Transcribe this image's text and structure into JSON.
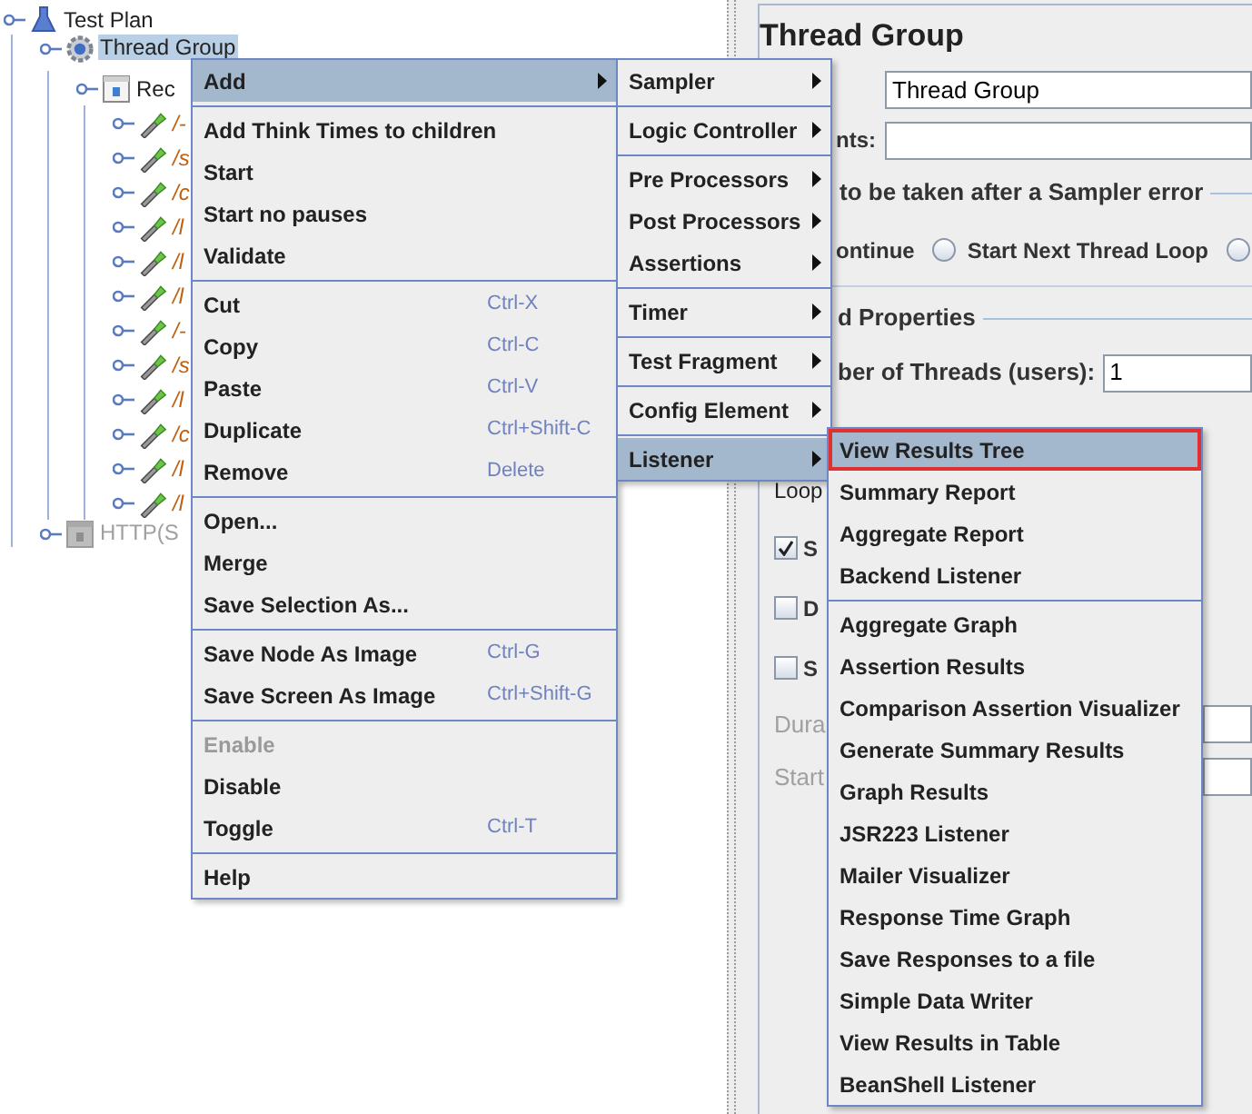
{
  "tree": [
    {
      "label": "Test Plan",
      "kind": "flask",
      "selected": false,
      "disabled": false,
      "children": [
        {
          "label": "Thread Group",
          "kind": "gear",
          "selected": true,
          "disabled": false,
          "children": [
            {
              "label": "Rec",
              "kind": "recorder",
              "selected": false,
              "disabled": false,
              "children": [
                {
                  "label": "/-",
                  "kind": "sampler",
                  "selected": false,
                  "disabled": false
                },
                {
                  "label": "/s",
                  "kind": "sampler",
                  "selected": false,
                  "disabled": false
                },
                {
                  "label": "/c",
                  "kind": "sampler",
                  "selected": false,
                  "disabled": false
                },
                {
                  "label": "/l",
                  "kind": "sampler",
                  "selected": false,
                  "disabled": false
                },
                {
                  "label": "/l",
                  "kind": "sampler",
                  "selected": false,
                  "disabled": false
                },
                {
                  "label": "/l",
                  "kind": "sampler",
                  "selected": false,
                  "disabled": false
                },
                {
                  "label": "/-",
                  "kind": "sampler",
                  "selected": false,
                  "disabled": false
                },
                {
                  "label": "/s",
                  "kind": "sampler",
                  "selected": false,
                  "disabled": false
                },
                {
                  "label": "/l",
                  "kind": "sampler",
                  "selected": false,
                  "disabled": false
                },
                {
                  "label": "/c",
                  "kind": "sampler",
                  "selected": false,
                  "disabled": false
                },
                {
                  "label": "/l",
                  "kind": "sampler",
                  "selected": false,
                  "disabled": false
                },
                {
                  "label": "/l",
                  "kind": "sampler",
                  "selected": false,
                  "disabled": false
                }
              ]
            }
          ]
        },
        {
          "label": "HTTP(S",
          "kind": "recorder",
          "selected": false,
          "disabled": true
        }
      ]
    }
  ],
  "panel": {
    "title": "Thread Group",
    "name_value": "Thread Group",
    "comments_label": "nts:",
    "error_legend": "to be taken after a Sampler error",
    "error_first_label": "ontinue",
    "error_options": [
      {
        "label": "Start Next Thread Loop",
        "selected": false
      },
      {
        "selected": false
      }
    ],
    "properties_legend": "d Properties",
    "threads_label": "ber of Threads (users):",
    "threads_value": "1",
    "loop_label": "Loop",
    "checkboxes": [
      {
        "label": "S",
        "checked": true
      },
      {
        "label": "D",
        "checked": false
      },
      {
        "label": "S",
        "checked": false
      }
    ],
    "disabled_rows": [
      {
        "label": "Dura"
      },
      {
        "label": "Start"
      }
    ]
  },
  "context_menu": [
    [
      {
        "label": "Add",
        "submenu": true,
        "selected": true,
        "disabled": false
      }
    ],
    [
      {
        "label": "Add Think Times to children",
        "submenu": false,
        "selected": false,
        "disabled": false
      },
      {
        "label": "Start",
        "submenu": false,
        "selected": false,
        "disabled": false
      },
      {
        "label": "Start no pauses",
        "submenu": false,
        "selected": false,
        "disabled": false
      },
      {
        "label": "Validate",
        "submenu": false,
        "selected": false,
        "disabled": false
      }
    ],
    [
      {
        "label": "Cut",
        "shortcut": "Ctrl-X",
        "submenu": false,
        "selected": false,
        "disabled": false
      },
      {
        "label": "Copy",
        "shortcut": "Ctrl-C",
        "submenu": false,
        "selected": false,
        "disabled": false
      },
      {
        "label": "Paste",
        "shortcut": "Ctrl-V",
        "submenu": false,
        "selected": false,
        "disabled": false
      },
      {
        "label": "Duplicate",
        "shortcut": "Ctrl+Shift-C",
        "submenu": false,
        "selected": false,
        "disabled": false
      },
      {
        "label": "Remove",
        "shortcut": "Delete",
        "submenu": false,
        "selected": false,
        "disabled": false
      }
    ],
    [
      {
        "label": "Open...",
        "submenu": false,
        "selected": false,
        "disabled": false
      },
      {
        "label": "Merge",
        "submenu": false,
        "selected": false,
        "disabled": false
      },
      {
        "label": "Save Selection As...",
        "submenu": false,
        "selected": false,
        "disabled": false
      }
    ],
    [
      {
        "label": "Save Node As Image",
        "shortcut": "Ctrl-G",
        "submenu": false,
        "selected": false,
        "disabled": false
      },
      {
        "label": "Save Screen As Image",
        "shortcut": "Ctrl+Shift-G",
        "submenu": false,
        "selected": false,
        "disabled": false
      }
    ],
    [
      {
        "label": "Enable",
        "submenu": false,
        "selected": false,
        "disabled": true
      },
      {
        "label": "Disable",
        "submenu": false,
        "selected": false,
        "disabled": false
      },
      {
        "label": "Toggle",
        "shortcut": "Ctrl-T",
        "submenu": false,
        "selected": false,
        "disabled": false
      }
    ],
    [
      {
        "label": "Help",
        "submenu": false,
        "selected": false,
        "disabled": false
      }
    ]
  ],
  "add_menu": [
    [
      {
        "label": "Sampler",
        "submenu": true,
        "selected": false
      }
    ],
    [
      {
        "label": "Logic Controller",
        "submenu": true,
        "selected": false
      }
    ],
    [
      {
        "label": "Pre Processors",
        "submenu": true,
        "selected": false
      },
      {
        "label": "Post Processors",
        "submenu": true,
        "selected": false
      },
      {
        "label": "Assertions",
        "submenu": true,
        "selected": false
      }
    ],
    [
      {
        "label": "Timer",
        "submenu": true,
        "selected": false
      }
    ],
    [
      {
        "label": "Test Fragment",
        "submenu": true,
        "selected": false
      }
    ],
    [
      {
        "label": "Config Element",
        "submenu": true,
        "selected": false
      }
    ],
    [
      {
        "label": "Listener",
        "submenu": true,
        "selected": true
      }
    ]
  ],
  "listener_menu": [
    [
      {
        "label": "View Results Tree",
        "selected": true,
        "outlined": true
      },
      {
        "label": "Summary Report",
        "selected": false,
        "outlined": false
      },
      {
        "label": "Aggregate Report",
        "selected": false,
        "outlined": false
      },
      {
        "label": "Backend Listener",
        "selected": false,
        "outlined": false
      }
    ],
    [
      {
        "label": "Aggregate Graph",
        "selected": false,
        "outlined": false
      },
      {
        "label": "Assertion Results",
        "selected": false,
        "outlined": false
      },
      {
        "label": "Comparison Assertion Visualizer",
        "selected": false,
        "outlined": false
      },
      {
        "label": "Generate Summary Results",
        "selected": false,
        "outlined": false
      },
      {
        "label": "Graph Results",
        "selected": false,
        "outlined": false
      },
      {
        "label": "JSR223 Listener",
        "selected": false,
        "outlined": false
      },
      {
        "label": "Mailer Visualizer",
        "selected": false,
        "outlined": false
      },
      {
        "label": "Response Time Graph",
        "selected": false,
        "outlined": false
      },
      {
        "label": "Save Responses to a file",
        "selected": false,
        "outlined": false
      },
      {
        "label": "Simple Data Writer",
        "selected": false,
        "outlined": false
      },
      {
        "label": "View Results in Table",
        "selected": false,
        "outlined": false
      },
      {
        "label": "BeanShell Listener",
        "selected": false,
        "outlined": false
      }
    ]
  ]
}
